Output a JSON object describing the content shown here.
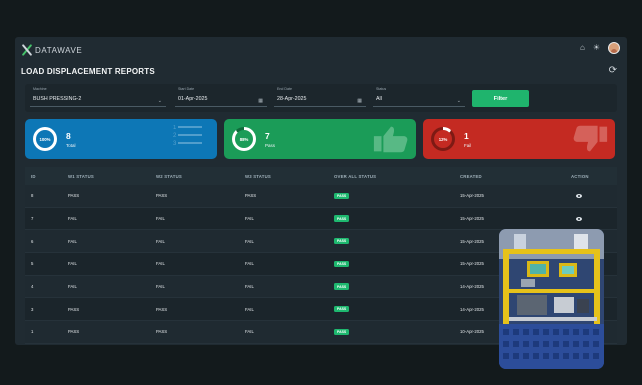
{
  "brand": {
    "name": "DATAWAVE"
  },
  "header": {
    "home_icon": "home-icon",
    "theme_icon": "sun-icon",
    "avatar": "user-avatar"
  },
  "page": {
    "title": "LOAD DISPLACEMENT REPORTS",
    "refresh_icon": "refresh-icon"
  },
  "filters": {
    "machine": {
      "label": "Machine",
      "value": "BUSH PRESSING-2"
    },
    "start_date": {
      "label": "Start Date",
      "value": "01-Apr-2025"
    },
    "end_date": {
      "label": "End Date",
      "value": "28-Apr-2025"
    },
    "status": {
      "label": "Status",
      "value": "All"
    },
    "button": "Filter"
  },
  "cards": [
    {
      "percent": "100%",
      "count": "8",
      "label": "Total",
      "color": "#0d77b6"
    },
    {
      "percent": "88%",
      "count": "7",
      "label": "Pass",
      "color": "#1b9c58"
    },
    {
      "percent": "12%",
      "count": "1",
      "label": "Fail",
      "color": "#c42a22"
    }
  ],
  "card_total_list": [
    "1",
    "2",
    "3"
  ],
  "table": {
    "columns": [
      "ID",
      "W1 STATUS",
      "W2 STATUS",
      "W3 STATUS",
      "OVER ALL STATUS",
      "CREATED",
      "ACTION"
    ],
    "rows": [
      {
        "id": "8",
        "w1": "PASS",
        "w2": "PASS",
        "w3": "PASS",
        "overall": "PASS",
        "created": "15-Apr-2025"
      },
      {
        "id": "7",
        "w1": "FAIL",
        "w2": "FAIL",
        "w3": "FAIL",
        "overall": "PASS",
        "created": "15-Apr-2025"
      },
      {
        "id": "6",
        "w1": "FAIL",
        "w2": "FAIL",
        "w3": "FAIL",
        "overall": "PASS",
        "created": "15-Apr-2025"
      },
      {
        "id": "5",
        "w1": "FAIL",
        "w2": "FAIL",
        "w3": "FAIL",
        "overall": "PASS",
        "created": "15-Apr-2025"
      },
      {
        "id": "4",
        "w1": "FAIL",
        "w2": "FAIL",
        "w3": "FAIL",
        "overall": "PASS",
        "created": "14-Apr-2025"
      },
      {
        "id": "3",
        "w1": "PASS",
        "w2": "PASS",
        "w3": "FAIL",
        "overall": "PASS",
        "created": "14-Apr-2025"
      },
      {
        "id": "1",
        "w1": "PASS",
        "w2": "PASS",
        "w3": "FAIL",
        "overall": "PASS",
        "created": "10-Apr-2025"
      }
    ]
  },
  "colors": {
    "accent": "#1fb46d",
    "bg": "#131a1c",
    "panel": "#202b32"
  }
}
